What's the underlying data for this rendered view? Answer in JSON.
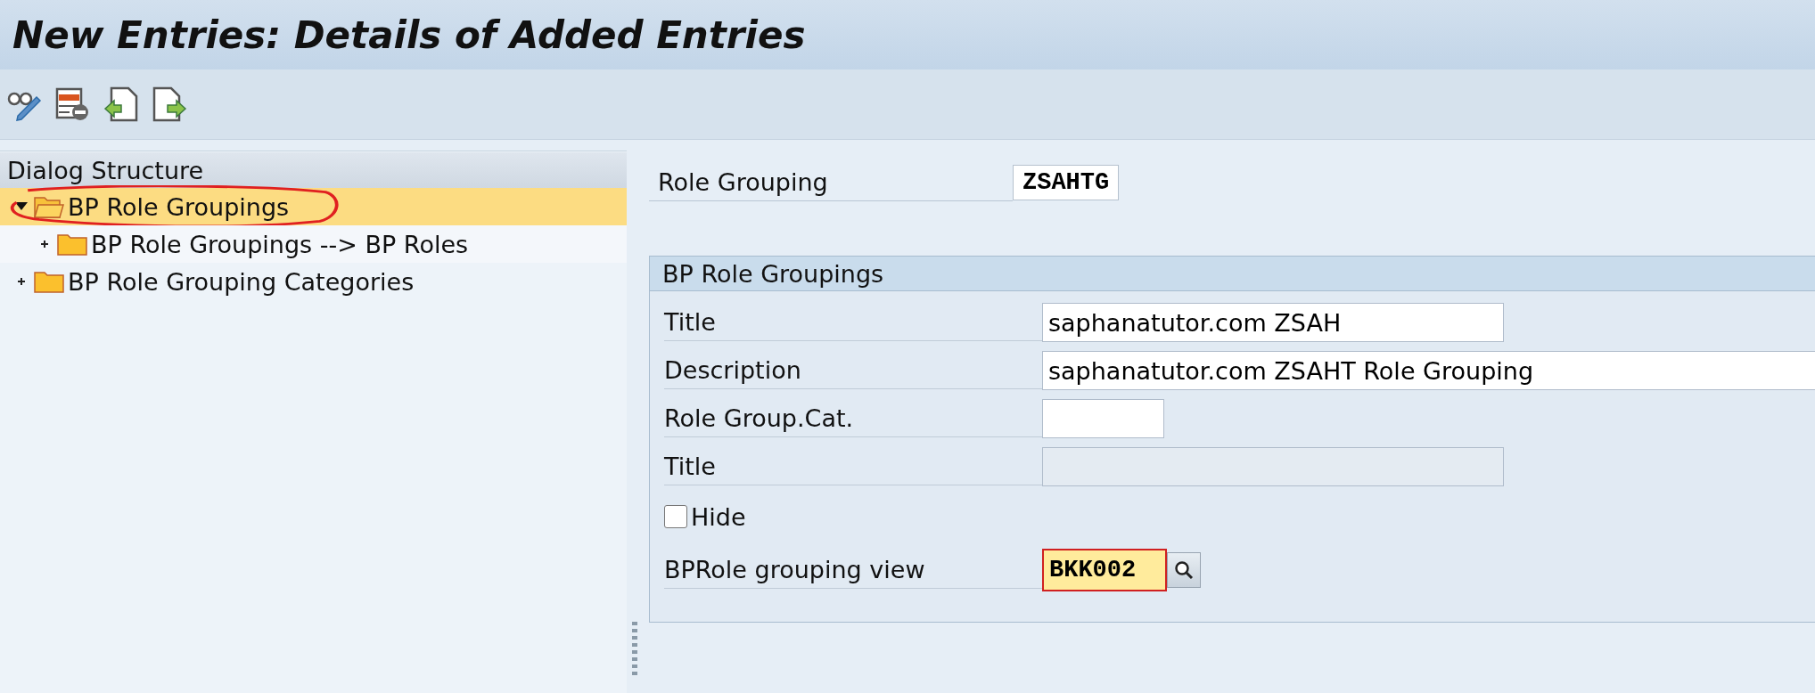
{
  "window": {
    "title": "New Entries: Details of Added Entries"
  },
  "toolbar": [
    {
      "kind": "glasses"
    },
    {
      "kind": "remove"
    },
    {
      "kind": "import"
    },
    {
      "kind": "export"
    }
  ],
  "dialog_structure": {
    "title": "Dialog Structure",
    "items": [
      {
        "label": "BP Role Groupings",
        "selected": true,
        "expanded": true,
        "children": [
          {
            "label": "BP Role Groupings --> BP Roles",
            "selected": false,
            "expanded": false
          }
        ]
      },
      {
        "label": "BP Role Grouping Categories",
        "selected": false,
        "expanded": false
      }
    ]
  },
  "key_field": {
    "label": "Role Grouping",
    "value": "ZSAHTG"
  },
  "group": {
    "title": "BP Role Groupings",
    "fields": [
      {
        "kind": "medium",
        "label": "Title",
        "value": "saphanatutor.com ZSAH"
      },
      {
        "kind": "long",
        "label": "Description",
        "value": "saphanatutor.com ZSAHT Role Grouping"
      },
      {
        "kind": "short",
        "label": "Role Group.Cat."
      },
      {
        "kind": "readonly",
        "label": "Title"
      },
      {
        "kind": "checkbox",
        "label": "Hide",
        "checked": false
      },
      {
        "kind": "lookup",
        "label": "BPRole grouping view",
        "value": "BKK002",
        "focused": true
      }
    ]
  }
}
